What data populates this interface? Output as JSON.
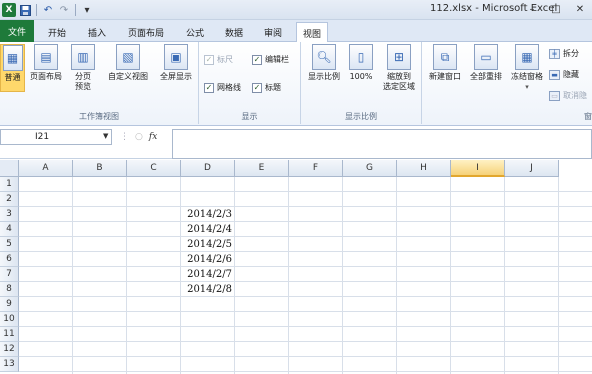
{
  "window": {
    "title": "112.xlsx - Microsoft Excel",
    "controls": [
      "–",
      "□",
      "✕"
    ]
  },
  "qat": {
    "app_icon": "excel-icon",
    "save_icon": "save-icon",
    "undo_icon": "undo-icon",
    "redo_icon": "redo-icon",
    "customize_icon": "dropdown-icon",
    "undo_glyph": "↶",
    "redo_glyph": "↷",
    "customize_glyph": "▾"
  },
  "tabs": [
    "文件",
    "开始",
    "插入",
    "页面布局",
    "公式",
    "数据",
    "审阅",
    "视图"
  ],
  "active_tab": "视图",
  "ribbon": {
    "workbook_views": {
      "label": "工作簿视图",
      "buttons": [
        "普通",
        "页面布局",
        "分页\n预览",
        "自定义视图",
        "全屏显示"
      ]
    },
    "show": {
      "label": "显示",
      "checkboxes": [
        {
          "label": "标尺",
          "checked": true,
          "disabled": true
        },
        {
          "label": "编辑栏",
          "checked": true,
          "disabled": false
        },
        {
          "label": "网格线",
          "checked": true,
          "disabled": false
        },
        {
          "label": "标题",
          "checked": true,
          "disabled": false
        }
      ]
    },
    "zoom": {
      "label": "显示比例",
      "buttons": [
        "显示比例",
        "100%",
        "缩放到\n选定区域"
      ]
    },
    "window": {
      "buttons": [
        "新建窗口",
        "全部重排",
        "冻结窗格"
      ],
      "small_buttons": [
        "拆分",
        "隐藏",
        "取消隐"
      ],
      "partial_label": "窗"
    }
  },
  "formula_bar": {
    "name_box": "I21",
    "fx": "fx",
    "formula": ""
  },
  "sheet": {
    "columns": [
      "A",
      "B",
      "C",
      "D",
      "E",
      "F",
      "G",
      "H",
      "I",
      "J"
    ],
    "selected_column": "I",
    "rows": [
      "1",
      "2",
      "3",
      "4",
      "5",
      "6",
      "7",
      "8",
      "9",
      "10",
      "11",
      "12",
      "13"
    ],
    "cells": [
      {
        "ref": "D3",
        "value": "2014/2/3"
      },
      {
        "ref": "D4",
        "value": "2014/2/4"
      },
      {
        "ref": "D5",
        "value": "2014/2/5"
      },
      {
        "ref": "D6",
        "value": "2014/2/6"
      },
      {
        "ref": "D7",
        "value": "2014/2/7"
      },
      {
        "ref": "D8",
        "value": "2014/2/8"
      }
    ]
  },
  "colors": {
    "file_tab": "#1e7a3a",
    "selected_header": "#f6d27a",
    "gridline": "#d8dfe9"
  }
}
